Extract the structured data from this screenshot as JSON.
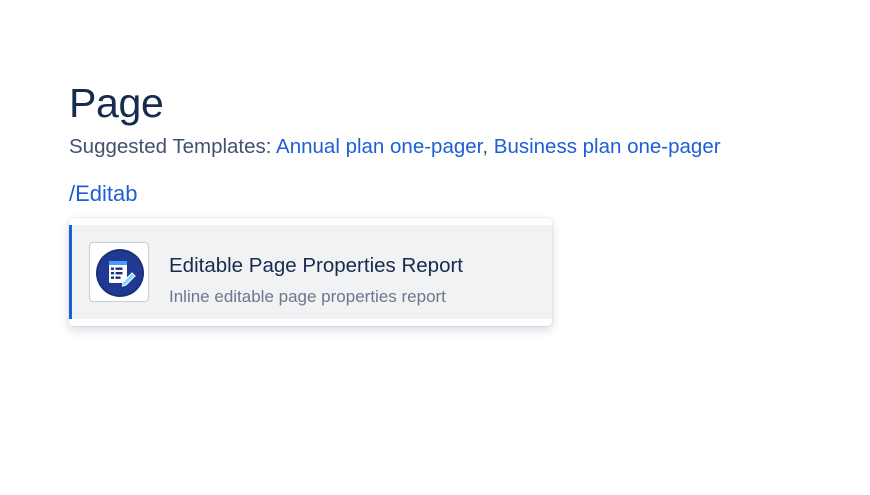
{
  "page": {
    "title": "Page"
  },
  "suggested_templates": {
    "label": "Suggested Templates: ",
    "links": [
      "Annual plan one-pager",
      "Business plan one-pager"
    ],
    "separator": ", "
  },
  "editor": {
    "slash_command_text": "/Editab"
  },
  "autocomplete": {
    "items": [
      {
        "icon": "editable-report-icon",
        "title": "Editable Page Properties Report",
        "description": "Inline editable page properties report",
        "selected": true
      }
    ]
  },
  "colors": {
    "link": "#1d5fd6",
    "title": "#172b4d",
    "selected_bg": "#f1f2f4",
    "icon_bg": "#1b2f7a"
  }
}
